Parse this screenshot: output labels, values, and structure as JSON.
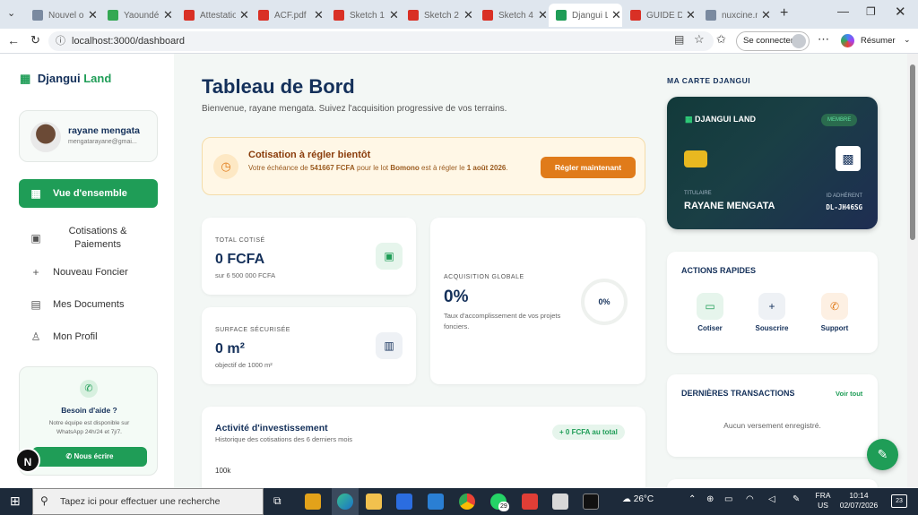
{
  "browser": {
    "tabs": [
      {
        "label": "Nouvel onglet",
        "color": "#7a8aa0"
      },
      {
        "label": "Yaoundé",
        "color": "#34a853"
      },
      {
        "label": "Attestation",
        "color": "#d93025"
      },
      {
        "label": "ACF.pdf",
        "color": "#d93025"
      },
      {
        "label": "Sketch 1",
        "color": "#d93025"
      },
      {
        "label": "Sketch 2",
        "color": "#d93025"
      },
      {
        "label": "Sketch 4",
        "color": "#d93025"
      },
      {
        "label": "Djangui Land",
        "color": "#1f9d57",
        "active": true
      },
      {
        "label": "GUIDE D'INSTALL",
        "color": "#d93025"
      },
      {
        "label": "nuxcine.net",
        "color": "#7a8aa0"
      }
    ],
    "url": "localhost:3000/dashboard",
    "signin_label": "Se connecter",
    "summarize_label": "Résumer"
  },
  "sidebar": {
    "brand_prefix": "Djangui",
    "brand_suffix": "Land",
    "user_name": "rayane mengata",
    "user_email": "mengatarayane@gmai...",
    "nav": [
      {
        "label": "Vue d'ensemble",
        "icon": "grid-icon",
        "active": true
      },
      {
        "label": "Cotisations & Paiements",
        "icon": "wallet-icon"
      },
      {
        "label": "Nouveau Foncier",
        "icon": "plus-icon"
      },
      {
        "label": "Mes Documents",
        "icon": "document-icon"
      },
      {
        "label": "Mon Profil",
        "icon": "user-icon"
      }
    ],
    "help": {
      "title": "Besoin d'aide ?",
      "text": "Notre équipe est disponible sur WhatsApp 24h/24 et 7j/7.",
      "button": "Nous écrire"
    },
    "avatar_letter": "N"
  },
  "main": {
    "title": "Tableau de Bord",
    "subtitle": "Bienvenue, rayane mengata. Suivez l'acquisition progressive de vos terrains.",
    "alert": {
      "title": "Cotisation à régler bientôt",
      "text_1": "Votre échéance de",
      "amount": "541667 FCFA",
      "text_2": "pour le lot",
      "lot": "Bomono",
      "text_3": "est à régler le",
      "date_1": "1 août",
      "date_2": "2026",
      "button": "Régler maintenant"
    },
    "total": {
      "label": "TOTAL COTISÉ",
      "value": "0 FCFA",
      "sub": "sur 6 500 000 FCFA"
    },
    "surface": {
      "label": "SURFACE SÉCURISÉE",
      "value": "0 m²",
      "sub": "objectif de 1000 m²"
    },
    "acquisition": {
      "label": "ACQUISITION GLOBALE",
      "value": "0%",
      "sub": "Taux d'accomplissement de vos projets fonciers.",
      "ring": "0%",
      "progress": 0
    },
    "activity": {
      "title": "Activité d'investissement",
      "sub": "Historique des cotisations des 6 derniers mois",
      "badge": "+ 0 FCFA au total",
      "tick": "100k"
    }
  },
  "right": {
    "card_title": "MA CARTE DJANGUI",
    "card_brand": "DJANGUI LAND",
    "card_badge": "MEMBRE",
    "holder_label": "TITULAIRE",
    "holder_name": "RAYANE MENGATA",
    "id_label": "ID ADHÉRENT",
    "id_value": "DL-JH46SG",
    "quick_title": "ACTIONS RAPIDES",
    "quick": [
      {
        "label": "Cotiser",
        "icon": "card-icon",
        "color": "#1f9d57",
        "bg": "#e6f5ec"
      },
      {
        "label": "Souscrire",
        "icon": "plus-icon",
        "color": "#14305a",
        "bg": "#eef1f5"
      },
      {
        "label": "Support",
        "icon": "phone-icon",
        "color": "#e07b1a",
        "bg": "#fdf0e3"
      }
    ],
    "tx_title": "DERNIÈRES TRANSACTIONS",
    "tx_link": "Voir tout",
    "tx_empty": "Aucun versement enregistré."
  },
  "taskbar": {
    "search": "Tapez ici pour effectuer une recherche",
    "weather": "26°C",
    "lang_1": "FRA",
    "lang_2": "US",
    "time": "10:14",
    "date": "02/07/2026",
    "notif": "23",
    "whatsapp_badge": "29"
  },
  "colors": {
    "green": "#1f9d57",
    "navy": "#14305a",
    "orange": "#e07b1a",
    "alert_bg": "#fff7e6"
  }
}
